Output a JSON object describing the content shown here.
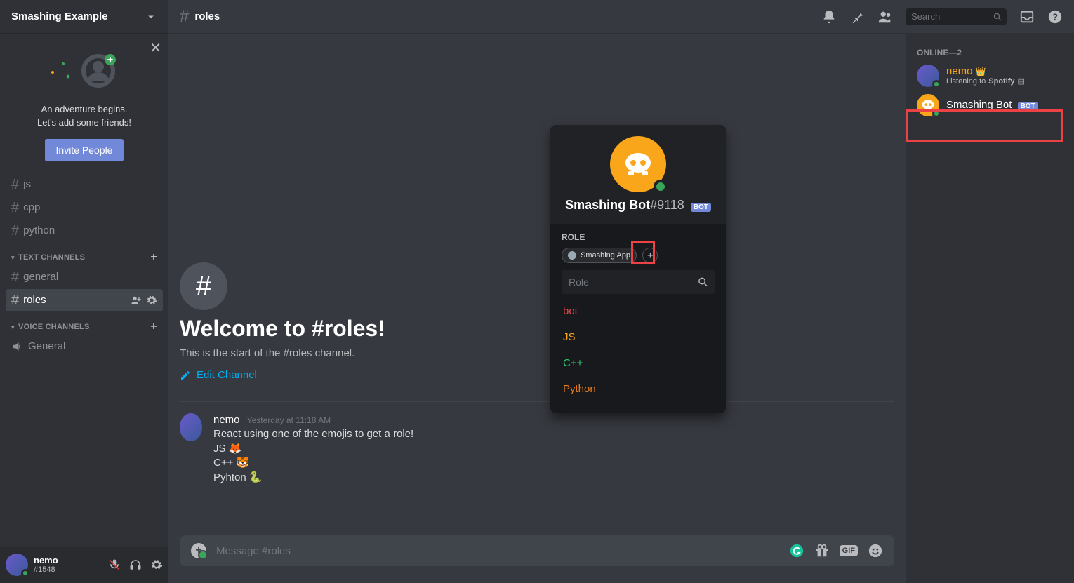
{
  "server": {
    "name": "Smashing Example"
  },
  "invite": {
    "line1": "An adventure begins.",
    "line2": "Let's add some friends!",
    "button": "Invite People"
  },
  "sidebar": {
    "loose_channels": [
      {
        "name": "js"
      },
      {
        "name": "cpp"
      },
      {
        "name": "python"
      }
    ],
    "categories": [
      {
        "name": "TEXT CHANNELS",
        "channels": [
          {
            "name": "general",
            "active": false
          },
          {
            "name": "roles",
            "active": true
          }
        ]
      },
      {
        "name": "VOICE CHANNELS",
        "voice_channels": [
          {
            "name": "General"
          }
        ]
      }
    ]
  },
  "current_user": {
    "name": "nemo",
    "tag": "#1548",
    "status_color": "#3ba55c"
  },
  "channel_header": {
    "name": "roles"
  },
  "search": {
    "placeholder": "Search"
  },
  "welcome": {
    "title": "Welcome to #roles!",
    "sub": "This is the start of the #roles channel.",
    "edit": "Edit Channel"
  },
  "messages": [
    {
      "author": "nemo",
      "timestamp": "Yesterday at 11:18 AM",
      "lines": [
        "React using one of the emojis to get a role!",
        "JS 🦊",
        "C++ 🐯",
        "Pyhton 🐍"
      ]
    }
  ],
  "composer": {
    "placeholder": "Message #roles"
  },
  "members": {
    "header": "ONLINE—2",
    "list": [
      {
        "name": "nemo",
        "color": "#faa61a",
        "crown": true,
        "sub_prefix": "Listening to ",
        "sub_bold": "Spotify",
        "status_color": "#3ba55c"
      },
      {
        "name": "Smashing Bot",
        "color": "#ffffff",
        "bot": true,
        "status_color": "#3ba55c"
      }
    ],
    "bot_badge": "BOT"
  },
  "popup": {
    "name": "Smashing Bot",
    "discriminator": "#9118",
    "bot_badge": "BOT",
    "section_label": "ROLE",
    "roles": [
      {
        "name": "Smashing App",
        "color": "#99aab5"
      }
    ],
    "search_placeholder": "Role",
    "options": [
      {
        "name": "bot",
        "color": "#f04747"
      },
      {
        "name": "JS",
        "color": "#faa61a"
      },
      {
        "name": "C++",
        "color": "#2ecc71"
      },
      {
        "name": "Python",
        "color": "#e67e22"
      }
    ]
  },
  "avatar_colors": {
    "nemo": "#5865a0",
    "bot": "#faa61a"
  }
}
